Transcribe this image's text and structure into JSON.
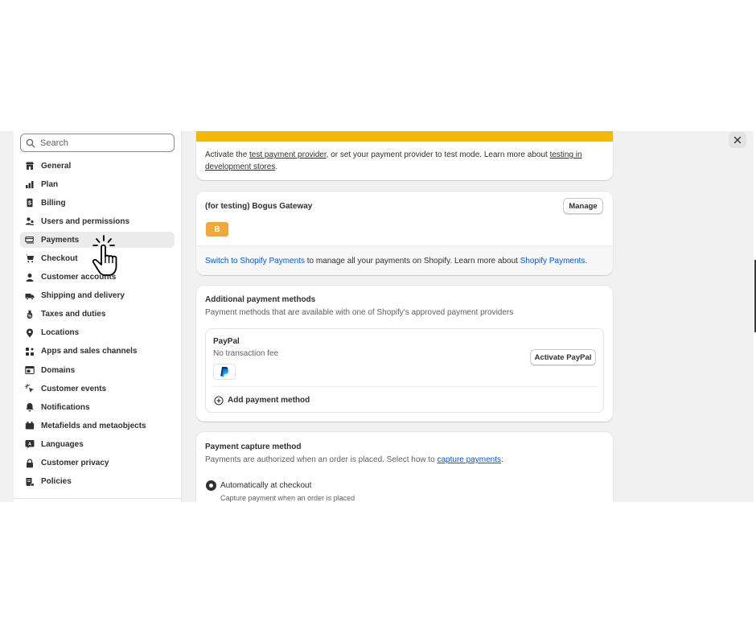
{
  "search": {
    "placeholder": "Search"
  },
  "sidebar": {
    "items": [
      {
        "label": "General",
        "icon": "store-icon"
      },
      {
        "label": "Plan",
        "icon": "plan-chart-icon"
      },
      {
        "label": "Billing",
        "icon": "receipt-icon"
      },
      {
        "label": "Users and permissions",
        "icon": "users-icon"
      },
      {
        "label": "Payments",
        "icon": "payments-icon",
        "active": true
      },
      {
        "label": "Checkout",
        "icon": "cart-icon"
      },
      {
        "label": "Customer accounts",
        "icon": "person-icon"
      },
      {
        "label": "Shipping and delivery",
        "icon": "truck-icon"
      },
      {
        "label": "Taxes and duties",
        "icon": "tax-icon"
      },
      {
        "label": "Locations",
        "icon": "location-pin-icon"
      },
      {
        "label": "Apps and sales channels",
        "icon": "apps-icon"
      },
      {
        "label": "Domains",
        "icon": "domain-icon"
      },
      {
        "label": "Customer events",
        "icon": "cursor-click-icon"
      },
      {
        "label": "Notifications",
        "icon": "bell-icon"
      },
      {
        "label": "Metafields and metaobjects",
        "icon": "metafields-icon"
      },
      {
        "label": "Languages",
        "icon": "language-icon"
      },
      {
        "label": "Customer privacy",
        "icon": "lock-icon"
      },
      {
        "label": "Policies",
        "icon": "policy-icon"
      }
    ]
  },
  "test_card": {
    "pre": "Activate the ",
    "link1": "test payment provider",
    "mid": ", or set your payment provider to test mode. Learn more about ",
    "link2": "testing in development stores",
    "post": "."
  },
  "gateway_card": {
    "title": "(for testing) Bogus Gateway",
    "manage_label": "Manage",
    "badge": "B",
    "badge_color": "#f0a83a",
    "switch_link": "Switch to Shopify Payments",
    "switch_text": " to manage all your payments on Shopify. Learn more about ",
    "learn_link": "Shopify Payments",
    "end": "."
  },
  "additional_card": {
    "title": "Additional payment methods",
    "subtitle": "Payment methods that are available with one of Shopify's approved payment providers",
    "paypal_name": "PayPal",
    "paypal_fee": "No transaction fee",
    "activate_label": "Activate PayPal",
    "add_method_label": "Add payment method"
  },
  "capture_card": {
    "title": "Payment capture method",
    "subtitle_pre": "Payments are authorized when an order is placed. Select how to ",
    "subtitle_link": "capture payments",
    "subtitle_post": ":",
    "option_label": "Automatically at checkout",
    "option_desc": "Capture payment when an order is placed"
  },
  "colors": {
    "accent": "#005bd3",
    "warning": "#f5b800",
    "background": "#f1f1f1"
  }
}
